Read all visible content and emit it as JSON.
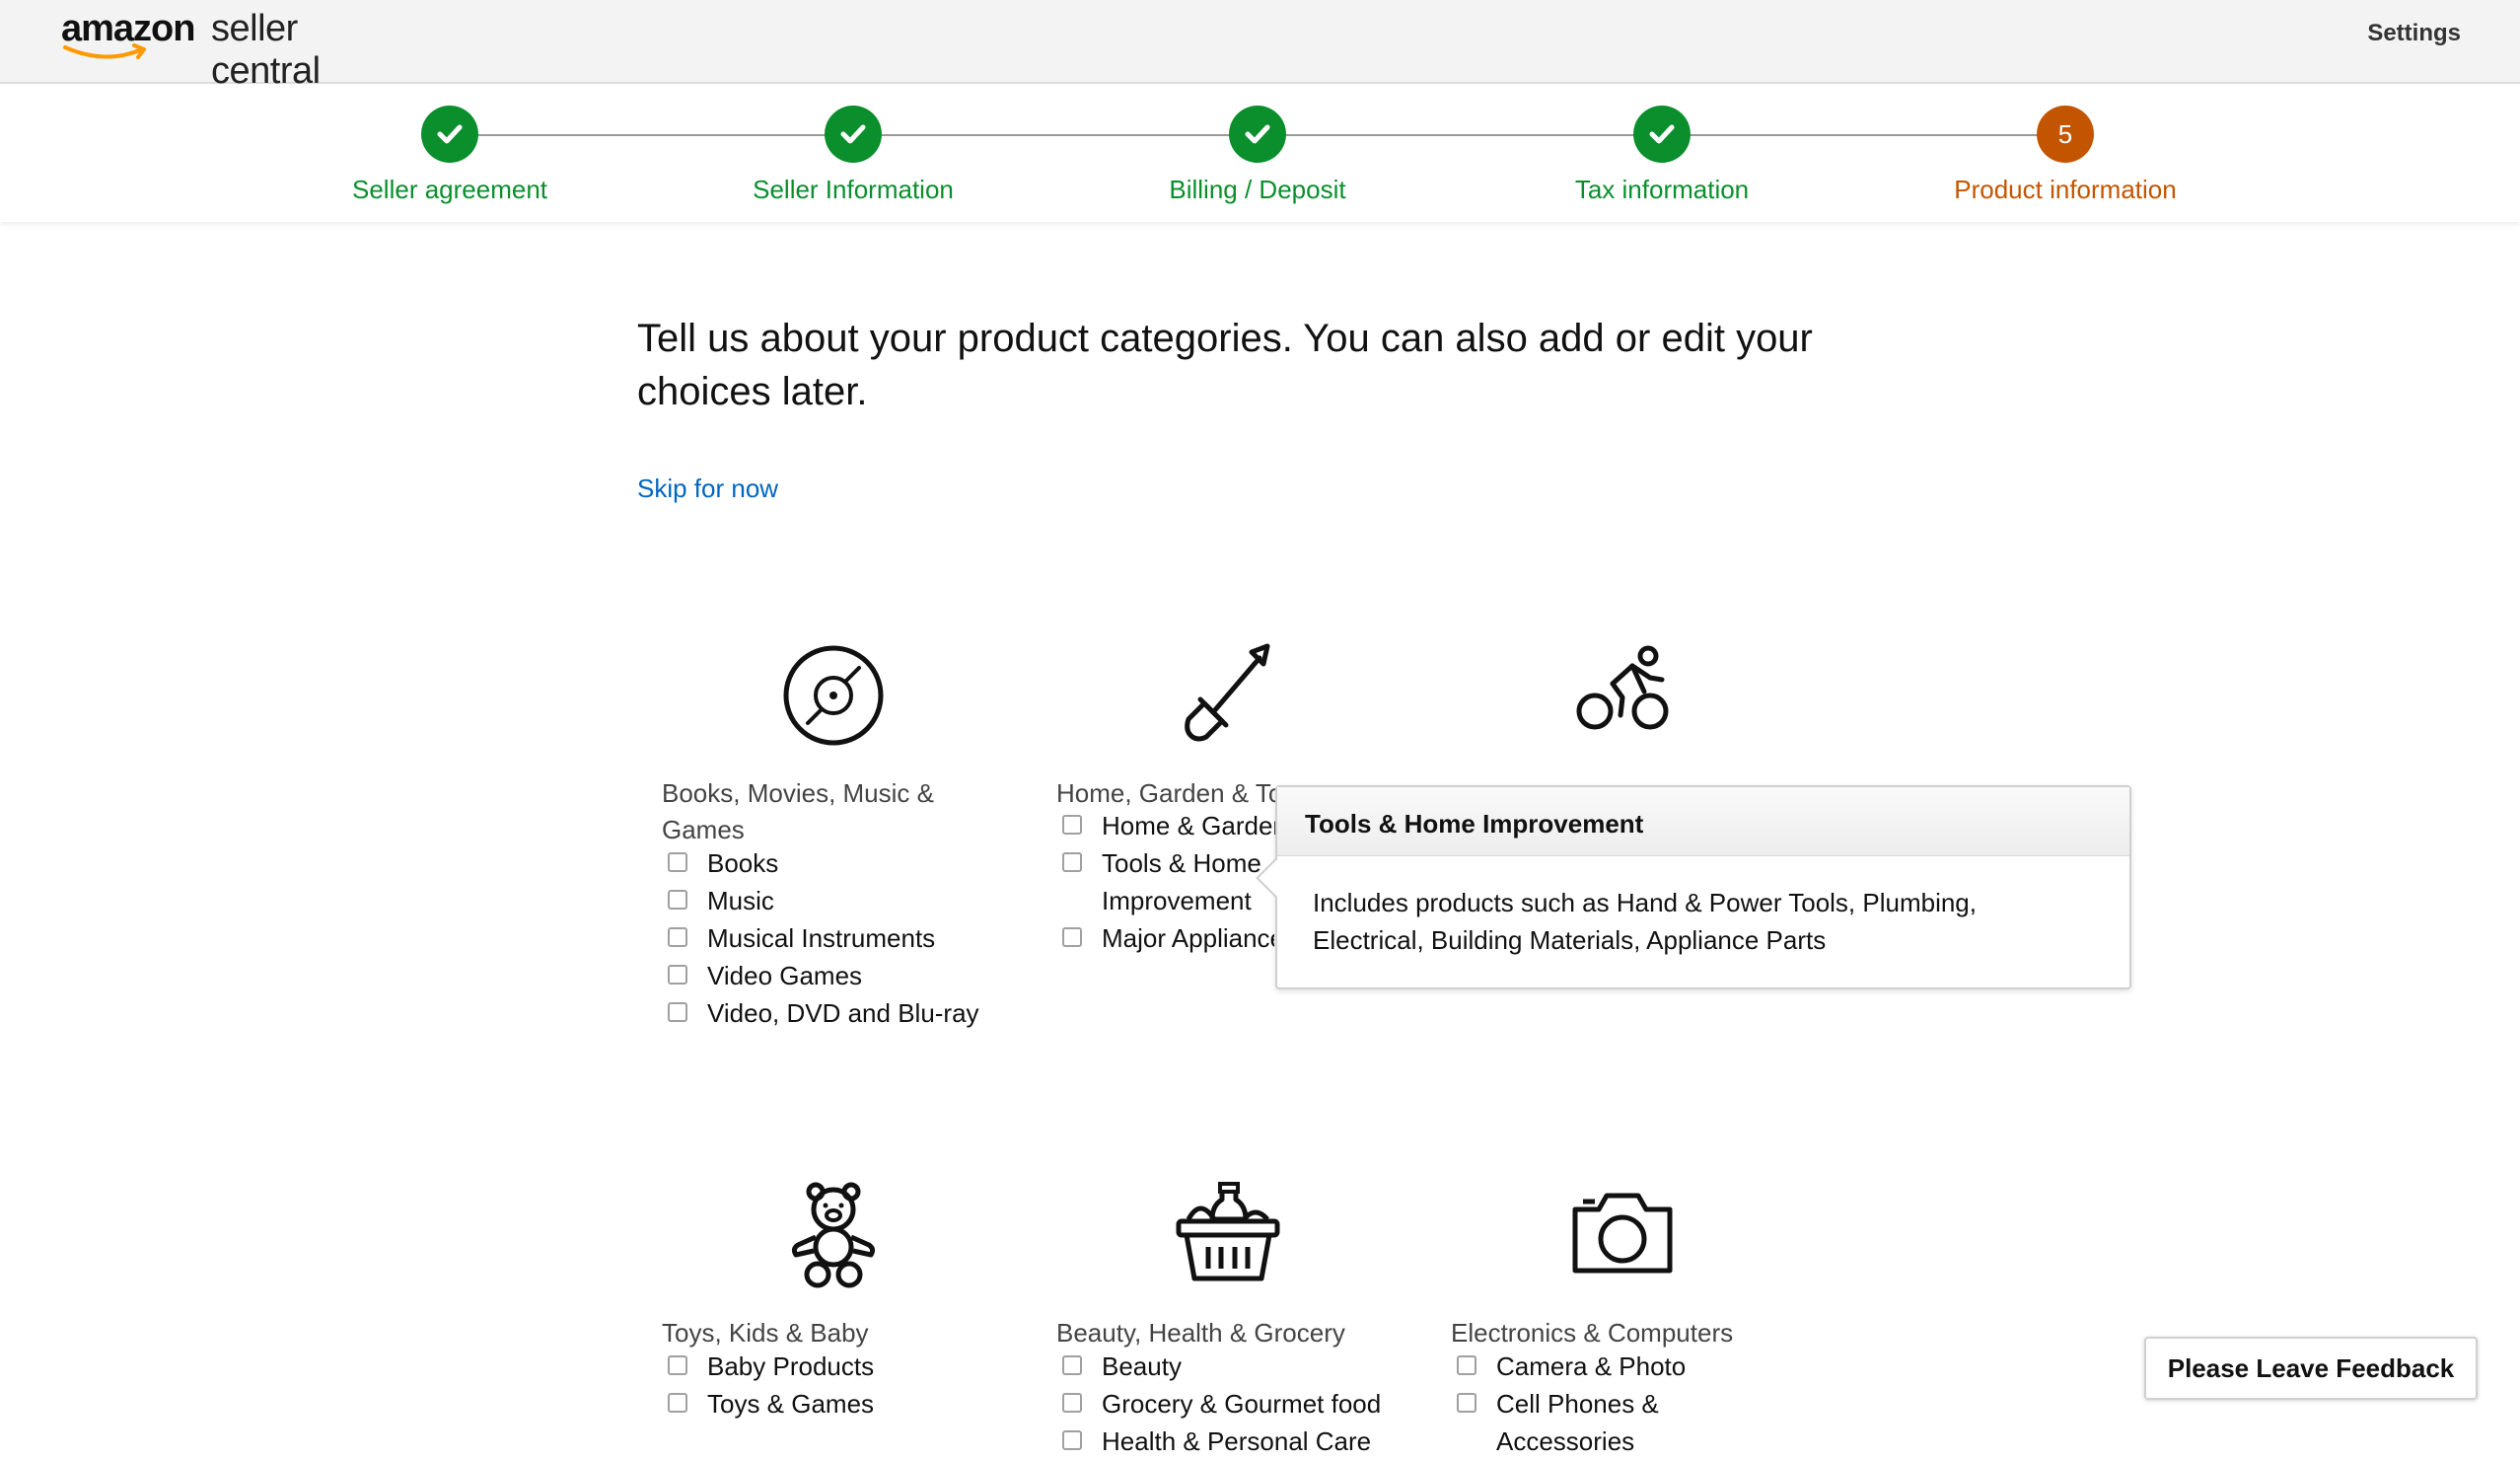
{
  "header": {
    "logo_bold": "amazon",
    "logo_rest": "seller central",
    "settings_label": "Settings"
  },
  "steps": [
    {
      "label": "Seller agreement",
      "status": "done"
    },
    {
      "label": "Seller Information",
      "status": "done"
    },
    {
      "label": "Billing / Deposit",
      "status": "done"
    },
    {
      "label": "Tax information",
      "status": "done"
    },
    {
      "label": "Product information",
      "status": "current",
      "number": "5"
    }
  ],
  "main": {
    "heading": "Tell us about your product categories. You can also add or edit your choices later.",
    "skip_label": "Skip for now"
  },
  "categories": [
    {
      "icon": "disc-icon",
      "title": "Books, Movies, Music & Games",
      "options": [
        "Books",
        "Music",
        "Musical Instruments",
        "Video Games",
        "Video, DVD and Blu-ray"
      ]
    },
    {
      "icon": "shovel-icon",
      "title": "Home, Garden & To",
      "options": [
        "Home & Garden",
        "Tools & Home Improvement",
        "Major Appliance"
      ]
    },
    {
      "icon": "cyclist-icon",
      "title": "",
      "options": []
    },
    {
      "icon": "teddy-bear-icon",
      "title": "Toys, Kids & Baby",
      "options": [
        "Baby Products",
        "Toys & Games"
      ]
    },
    {
      "icon": "grocery-basket-icon",
      "title": "Beauty, Health & Grocery",
      "options": [
        "Beauty",
        "Grocery & Gourmet food",
        "Health & Personal Care"
      ]
    },
    {
      "icon": "camera-icon",
      "title": "Electronics & Computers",
      "options": [
        "Camera & Photo",
        "Cell Phones & Accessories"
      ]
    }
  ],
  "popover": {
    "title": "Tools & Home Improvement",
    "body": "Includes products such as Hand & Power Tools, Plumbing, Electrical, Building Materials, Appliance Parts"
  },
  "feedback_label": "Please Leave Feedback",
  "colors": {
    "success": "#0a8f2c",
    "current_step": "#c45500",
    "link": "#0066c0",
    "topbar_bg": "#f3f3f3"
  }
}
